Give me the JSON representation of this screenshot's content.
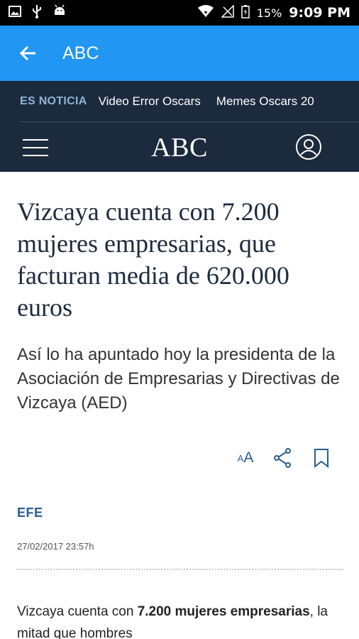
{
  "status_bar": {
    "battery": "15%",
    "time": "9:09 PM",
    "icons": [
      "image-icon",
      "usb-icon",
      "android-icon",
      "wifi-icon",
      "no-sim-icon",
      "battery-icon"
    ]
  },
  "app_bar": {
    "title": "ABC",
    "background": "#2196f3"
  },
  "site_header": {
    "background": "#1c2a3d",
    "trending_label": "ES NOTICIA",
    "trending_links": [
      "Video Error Oscars",
      "Memes Oscars 20"
    ],
    "logo": "ABC"
  },
  "article": {
    "headline": "Vizcaya cuenta con 7.200 mujeres empresarias, que facturan media de 620.000 euros",
    "subtitle": "Así lo ha apuntado hoy la presidenta de la Asociación de Empresarias y Directivas de Vizcaya (AED)",
    "font_size_small": "A",
    "font_size_big": "A",
    "author": "EFE",
    "date": "27/02/2017 23:57h",
    "body": {
      "part1": "Vizcaya cuenta con ",
      "bold": "7.200 mujeres empresarias",
      "part2": ", la mitad que hombres"
    }
  }
}
